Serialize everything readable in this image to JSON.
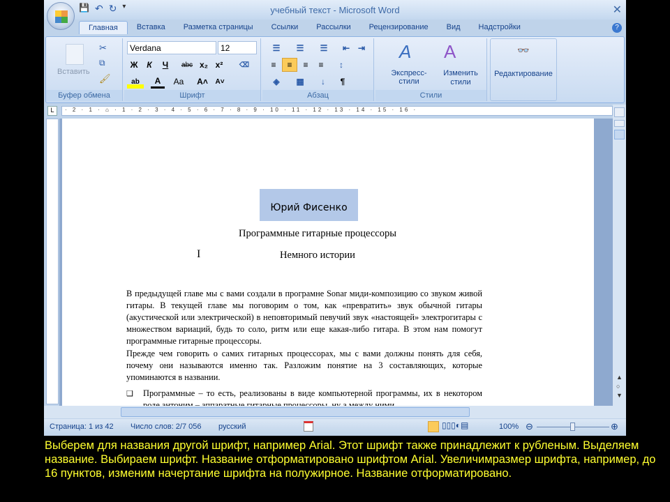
{
  "window": {
    "title": "учебный текст - Microsoft Word",
    "close": "✕"
  },
  "qat": {
    "save": "💾",
    "undo": "↶",
    "redo": "↻",
    "more": "▾"
  },
  "tabs": [
    "Главная",
    "Вставка",
    "Разметка страницы",
    "Ссылки",
    "Рассылки",
    "Рецензирование",
    "Вид",
    "Надстройки"
  ],
  "help": "?",
  "ribbon": {
    "clipboard": {
      "paste": "Вставить",
      "label": "Буфер обмена"
    },
    "font": {
      "name": "Verdana",
      "size": "12",
      "bold": "Ж",
      "italic": "К",
      "underline": "Ч",
      "strike": "abc",
      "sub": "x₂",
      "sup": "x²",
      "case": "Aa",
      "grow": "A˄",
      "shrink": "A˅",
      "label": "Шрифт"
    },
    "paragraph": {
      "pilcrow": "¶",
      "label": "Абзац"
    },
    "styles": {
      "express": "Экспресс-стили",
      "change": "Изменить стили",
      "label": "Стили"
    },
    "editing": {
      "label": "Редактирование"
    }
  },
  "ruler": "· 2 · 1 · ⌂ · 1 · 2 · 3 · 4 · 5 · 6 · 7 · 8 · 9 · 10 · 11 · 12 · 13 · 14 · 15 · 16 · ",
  "document": {
    "author": "Юрий Фисенко",
    "title": "Программные гитарные процессоры",
    "subtitle": "Немного истории",
    "para1": "В предыдущей главе мы с вами создали в програмне Sonar миди-композицию со звуком живой гитары. В текущей главе мы поговорим о том, как «превратить» звук обычной гитары (акустической или электрической) в неповторимый певучий звук «настоящей» электрогитары с множеством вариаций, будь то соло, ритм или еще какая-либо гитара. В этом нам помогут программные гитарные процессоры.",
    "para2": "Прежде чем говорить о самих гитарных процессорах, мы с вами должны понять для себя, почему они называются именно так. Разложим понятие на 3 составляющих, которые упоминаются в названии.",
    "bullet": "Программные – то есть, реализованы в виде компьютерной программы, их в некотором роде антоним – аппаратные гитарные процессоры, ну а между ними"
  },
  "status": {
    "page": "Страница: 1 из 42",
    "words": "Число слов: 2/7 056",
    "lang": "русский",
    "zoom": "100%"
  },
  "caption": "Выберем для названия другой шрифт, например Arial. Этот шрифт также принадлежит к рубленым. Выделяем название. Выбираем шрифт. Название отформатировано шрифтом Arial. Увеличимразмер шрифта, например, до 16 пунктов, изменим начертание шрифта на полужирное. Название отформатировано."
}
